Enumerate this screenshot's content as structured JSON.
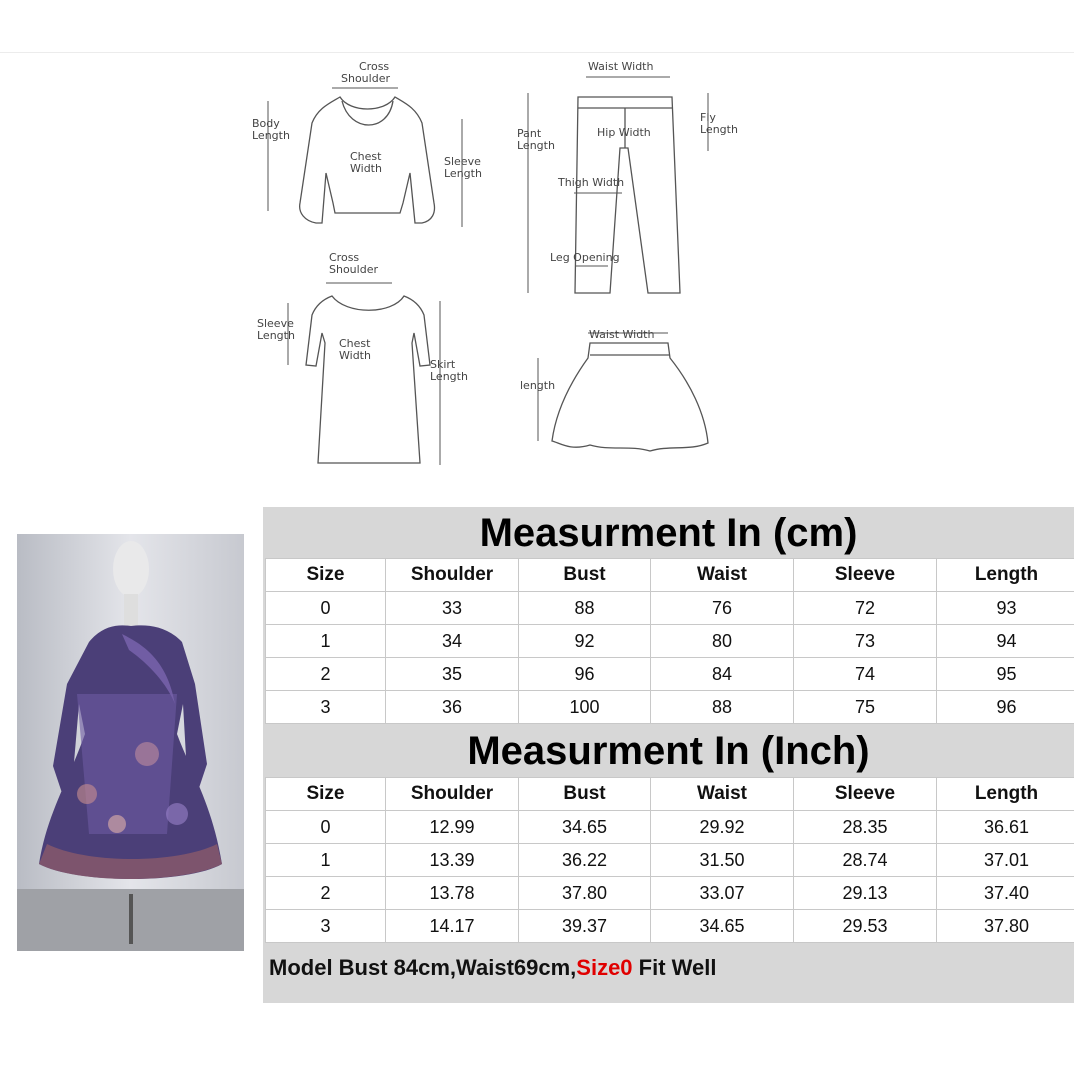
{
  "diagram_labels": {
    "top_cross_shoulder": [
      "Cross",
      "Shoulder"
    ],
    "body_length": [
      "Body",
      "Length"
    ],
    "chest_width": [
      "Chest",
      "Width"
    ],
    "sleeve_length": [
      "Sleeve",
      "Length"
    ],
    "waist_width": "Waist Width",
    "pant_length": [
      "Pant",
      "Length"
    ],
    "fly_length": [
      "Fly",
      "Length"
    ],
    "hip_width": "Hip Width",
    "thigh_width": "Thigh Width",
    "leg_opening": "Leg Opening",
    "dress_cross_shoulder": [
      "Cross",
      "Shoulder"
    ],
    "dress_sleeve_length": [
      "Sleeve",
      "Length"
    ],
    "dress_chest_width": [
      "Chest",
      "Width"
    ],
    "skirt_length": [
      "Skirt",
      "Length"
    ],
    "skirt_waist_width": "Waist Width",
    "skirt_length_small": "length"
  },
  "cm_table": {
    "title": "Measurment In (cm)",
    "headers": [
      "Size",
      "Shoulder",
      "Bust",
      "Waist",
      "Sleeve",
      "Length"
    ],
    "rows": [
      [
        "0",
        "33",
        "88",
        "76",
        "72",
        "93"
      ],
      [
        "1",
        "34",
        "92",
        "80",
        "73",
        "94"
      ],
      [
        "2",
        "35",
        "96",
        "84",
        "74",
        "95"
      ],
      [
        "3",
        "36",
        "100",
        "88",
        "75",
        "96"
      ]
    ]
  },
  "inch_table": {
    "title": "Measurment In (Inch)",
    "headers": [
      "Size",
      "Shoulder",
      "Bust",
      "Waist",
      "Sleeve",
      "Length"
    ],
    "rows": [
      [
        "0",
        "12.99",
        "34.65",
        "29.92",
        "28.35",
        "36.61"
      ],
      [
        "1",
        "13.39",
        "36.22",
        "31.50",
        "28.74",
        "37.01"
      ],
      [
        "2",
        "13.78",
        "37.80",
        "33.07",
        "29.13",
        "37.40"
      ],
      [
        "3",
        "14.17",
        "39.37",
        "34.65",
        "29.53",
        "37.80"
      ]
    ]
  },
  "note": {
    "prefix": "Model Bust 84cm,Waist69cm,",
    "highlight": "Size0",
    "suffix": " Fit Well",
    "highlight_color": "#e00000"
  }
}
